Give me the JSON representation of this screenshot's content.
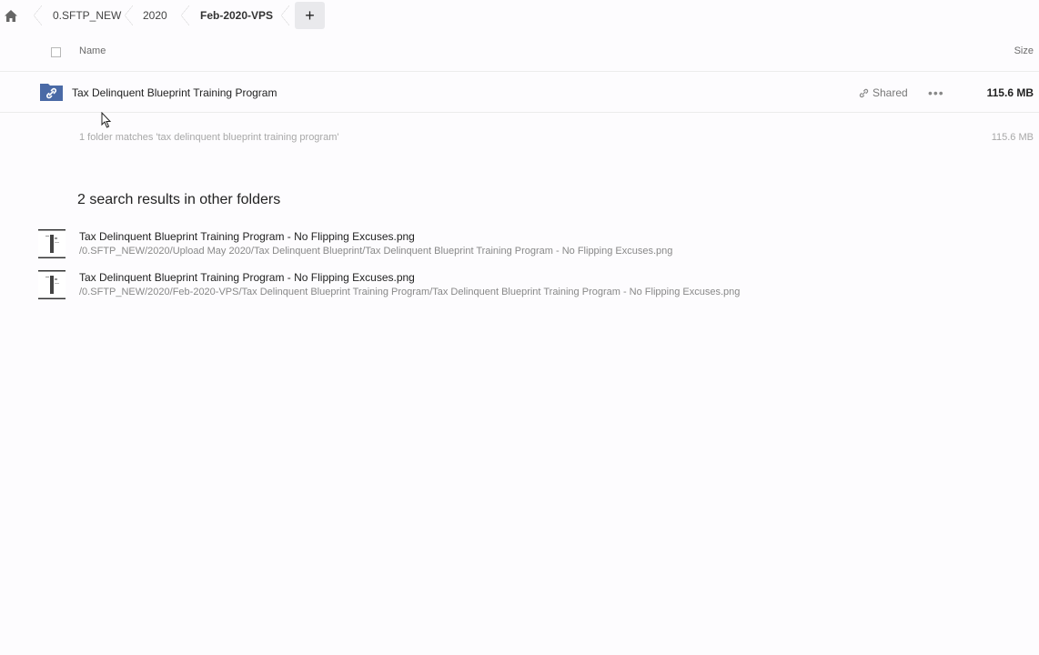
{
  "breadcrumb": {
    "items": [
      {
        "label": "0.SFTP_NEW"
      },
      {
        "label": "2020"
      },
      {
        "label": "Feb-2020-VPS"
      }
    ],
    "home_icon": "home-icon",
    "add_label": "+"
  },
  "table_header": {
    "name": "Name",
    "size": "Size"
  },
  "folder": {
    "name": "Tax Delinquent Blueprint Training Program",
    "shared_label": "Shared",
    "more_label": "•••",
    "size": "115.6 MB",
    "icon": "shared-folder-icon",
    "icon_color": "#4a6aa6"
  },
  "summary": {
    "text": "1 folder matches 'tax delinquent blueprint training program'",
    "size": "115.6 MB"
  },
  "other_results": {
    "title": "2 search results in other folders",
    "items": [
      {
        "name": "Tax Delinquent Blueprint Training Program - No Flipping Excuses.png",
        "path": "/0.SFTP_NEW/2020/Upload May 2020/Tax Delinquent Blueprint/Tax Delinquent Blueprint Training Program - No Flipping Excuses.png"
      },
      {
        "name": "Tax Delinquent Blueprint Training Program - No Flipping Excuses.png",
        "path": "/0.SFTP_NEW/2020/Feb-2020-VPS/Tax Delinquent Blueprint Training Program/Tax Delinquent Blueprint Training Program - No Flipping Excuses.png"
      }
    ]
  }
}
